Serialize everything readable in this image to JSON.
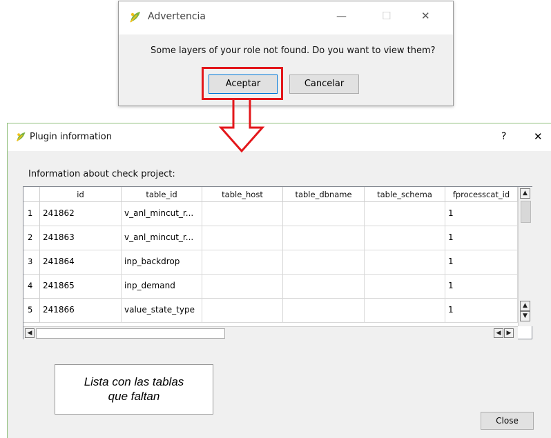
{
  "warning_dialog": {
    "title": "Advertencia",
    "minimize_glyph": "—",
    "maximize_glyph": "☐",
    "close_glyph": "✕",
    "message": "Some layers of your role not found. Do you want to view them?",
    "accept_label": "Aceptar",
    "cancel_label": "Cancelar"
  },
  "plugin_dialog": {
    "title": "Plugin information",
    "help_glyph": "?",
    "close_glyph": "✕",
    "label": "Information about check project:",
    "close_button": "Close"
  },
  "table": {
    "columns": [
      "id",
      "table_id",
      "table_host",
      "table_dbname",
      "table_schema",
      "fprocesscat_id"
    ],
    "rows": [
      {
        "num": "1",
        "cells": [
          "241862",
          "v_anl_mincut_r...",
          "",
          "",
          "",
          "1"
        ]
      },
      {
        "num": "2",
        "cells": [
          "241863",
          "v_anl_mincut_r...",
          "",
          "",
          "",
          "1"
        ]
      },
      {
        "num": "3",
        "cells": [
          "241864",
          "inp_backdrop",
          "",
          "",
          "",
          "1"
        ]
      },
      {
        "num": "4",
        "cells": [
          "241865",
          "inp_demand",
          "",
          "",
          "",
          "1"
        ]
      },
      {
        "num": "5",
        "cells": [
          "241866",
          "value_state_type",
          "",
          "",
          "",
          "1"
        ]
      }
    ]
  },
  "annotation": {
    "line1": "Lista con las tablas",
    "line2": "que faltan",
    "highlight_color": "#e3171b"
  },
  "icons": {
    "app_icon": "qgis-logo-icon"
  }
}
